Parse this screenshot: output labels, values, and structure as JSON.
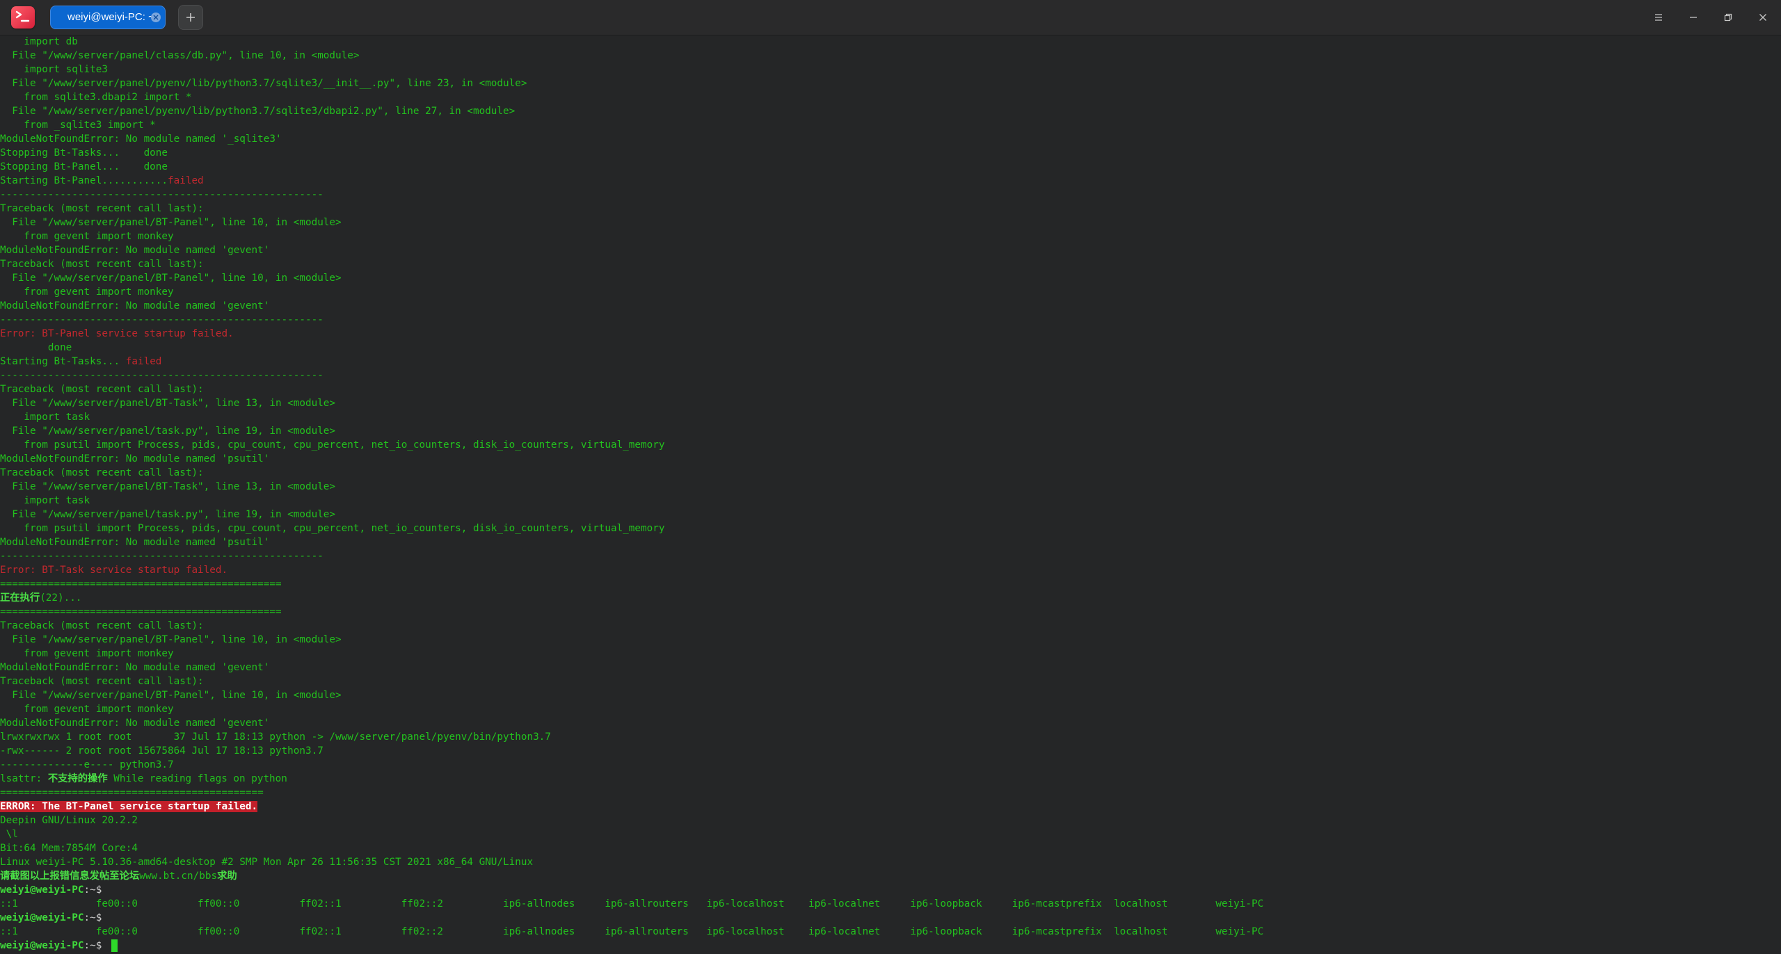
{
  "window": {
    "tab_title": "weiyi@weiyi-PC: ~",
    "icons": {
      "logo": "terminal-logo-icon",
      "tab_close": "close-icon",
      "add_tab": "plus-icon",
      "menu": "menu-icon",
      "minimize": "minimize-icon",
      "maximize": "restore-icon",
      "close": "close-icon"
    }
  },
  "terminal": {
    "lines": [
      [
        [
          "    import db",
          "green"
        ]
      ],
      [
        [
          "  File \"/www/server/panel/class/db.py\", line 10, in <module>",
          "green"
        ]
      ],
      [
        [
          "    import sqlite3",
          "green"
        ]
      ],
      [
        [
          "  File \"/www/server/panel/pyenv/lib/python3.7/sqlite3/__init__.py\", line 23, in <module>",
          "green"
        ]
      ],
      [
        [
          "    from sqlite3.dbapi2 import *",
          "green"
        ]
      ],
      [
        [
          "  File \"/www/server/panel/pyenv/lib/python3.7/sqlite3/dbapi2.py\", line 27, in <module>",
          "green"
        ]
      ],
      [
        [
          "    from _sqlite3 import *",
          "green"
        ]
      ],
      [
        [
          "ModuleNotFoundError: No module named '_sqlite3'",
          "green"
        ]
      ],
      [
        [
          "Stopping Bt-Tasks...    done",
          "green"
        ]
      ],
      [
        [
          "Stopping Bt-Panel...    done",
          "green"
        ]
      ],
      [
        [
          "Starting Bt-Panel...........",
          "green"
        ],
        [
          "failed",
          "red"
        ]
      ],
      [
        [
          "------------------------------------------------------",
          "green"
        ]
      ],
      [
        [
          "Traceback (most recent call last):",
          "green"
        ]
      ],
      [
        [
          "  File \"/www/server/panel/BT-Panel\", line 10, in <module>",
          "green"
        ]
      ],
      [
        [
          "    from gevent import monkey",
          "green"
        ]
      ],
      [
        [
          "ModuleNotFoundError: No module named 'gevent'",
          "green"
        ]
      ],
      [
        [
          "Traceback (most recent call last):",
          "green"
        ]
      ],
      [
        [
          "  File \"/www/server/panel/BT-Panel\", line 10, in <module>",
          "green"
        ]
      ],
      [
        [
          "    from gevent import monkey",
          "green"
        ]
      ],
      [
        [
          "ModuleNotFoundError: No module named 'gevent'",
          "green"
        ]
      ],
      [
        [
          "------------------------------------------------------",
          "green"
        ]
      ],
      [
        [
          "Error: BT-Panel service startup failed.",
          "red"
        ]
      ],
      [
        [
          "        done",
          "green"
        ]
      ],
      [
        [
          "Starting Bt-Tasks... ",
          "green"
        ],
        [
          "failed",
          "red"
        ]
      ],
      [
        [
          "------------------------------------------------------",
          "green"
        ]
      ],
      [
        [
          "Traceback (most recent call last):",
          "green"
        ]
      ],
      [
        [
          "  File \"/www/server/panel/BT-Task\", line 13, in <module>",
          "green"
        ]
      ],
      [
        [
          "    import task",
          "green"
        ]
      ],
      [
        [
          "  File \"/www/server/panel/task.py\", line 19, in <module>",
          "green"
        ]
      ],
      [
        [
          "    from psutil import Process, pids, cpu_count, cpu_percent, net_io_counters, disk_io_counters, virtual_memory",
          "green"
        ]
      ],
      [
        [
          "ModuleNotFoundError: No module named 'psutil'",
          "green"
        ]
      ],
      [
        [
          "Traceback (most recent call last):",
          "green"
        ]
      ],
      [
        [
          "  File \"/www/server/panel/BT-Task\", line 13, in <module>",
          "green"
        ]
      ],
      [
        [
          "    import task",
          "green"
        ]
      ],
      [
        [
          "  File \"/www/server/panel/task.py\", line 19, in <module>",
          "green"
        ]
      ],
      [
        [
          "    from psutil import Process, pids, cpu_count, cpu_percent, net_io_counters, disk_io_counters, virtual_memory",
          "green"
        ]
      ],
      [
        [
          "ModuleNotFoundError: No module named 'psutil'",
          "green"
        ]
      ],
      [
        [
          "------------------------------------------------------",
          "green"
        ]
      ],
      [
        [
          "Error: BT-Task service startup failed.",
          "red"
        ]
      ],
      [
        [
          "===============================================",
          "green"
        ]
      ],
      [
        [
          "正在执行",
          "boldgreen"
        ],
        [
          "(22)...",
          "green"
        ]
      ],
      [
        [
          "===============================================",
          "green"
        ]
      ],
      [
        [
          "Traceback (most recent call last):",
          "green"
        ]
      ],
      [
        [
          "  File \"/www/server/panel/BT-Panel\", line 10, in <module>",
          "green"
        ]
      ],
      [
        [
          "    from gevent import monkey",
          "green"
        ]
      ],
      [
        [
          "ModuleNotFoundError: No module named 'gevent'",
          "green"
        ]
      ],
      [
        [
          "Traceback (most recent call last):",
          "green"
        ]
      ],
      [
        [
          "  File \"/www/server/panel/BT-Panel\", line 10, in <module>",
          "green"
        ]
      ],
      [
        [
          "    from gevent import monkey",
          "green"
        ]
      ],
      [
        [
          "ModuleNotFoundError: No module named 'gevent'",
          "green"
        ]
      ],
      [
        [
          "lrwxrwxrwx 1 root root       37 Jul 17 18:13 python -> /www/server/panel/pyenv/bin/python3.7",
          "green"
        ]
      ],
      [
        [
          "-rwx------ 2 root root 15675864 Jul 17 18:13 python3.7",
          "green"
        ]
      ],
      [
        [
          "--------------e---- python3.7",
          "green"
        ]
      ],
      [
        [
          "lsattr: ",
          "green"
        ],
        [
          "不支持的操作",
          "boldgreen"
        ],
        [
          " While reading flags on python",
          "green"
        ]
      ],
      [
        [
          "============================================",
          "green"
        ]
      ],
      [
        [
          "ERROR: The BT-Panel service startup failed.",
          "err"
        ]
      ],
      [
        [
          "Deepin GNU/Linux 20.2.2",
          "green"
        ]
      ],
      [
        [
          " \\l",
          "green"
        ]
      ],
      [
        [
          "Bit:64 Mem:7854M Core:4",
          "green"
        ]
      ],
      [
        [
          "Linux weiyi-PC 5.10.36-amd64-desktop #2 SMP Mon Apr 26 11:56:35 CST 2021 x86_64 GNU/Linux",
          "green"
        ]
      ],
      [
        [
          "请截图以上报错信息发帖至论坛",
          "boldgreen"
        ],
        [
          "www.bt.cn/bbs",
          "green"
        ],
        [
          "求助",
          "boldgreen"
        ]
      ],
      [
        [
          "weiyi@weiyi-PC",
          "prompt"
        ],
        [
          ":~$",
          "white"
        ]
      ],
      [
        [
          "::1             fe00::0          ff00::0          ff02::1          ff02::2          ip6-allnodes     ip6-allrouters   ip6-localhost    ip6-localnet     ip6-loopback     ip6-mcastprefix  localhost        weiyi-PC",
          "green"
        ]
      ],
      [
        [
          "weiyi@weiyi-PC",
          "prompt"
        ],
        [
          ":~$",
          "white"
        ]
      ],
      [
        [
          "::1             fe00::0          ff00::0          ff02::1          ff02::2          ip6-allnodes     ip6-allrouters   ip6-localhost    ip6-localnet     ip6-loopback     ip6-mcastprefix  localhost        weiyi-PC",
          "green"
        ]
      ],
      [
        [
          "weiyi@weiyi-PC",
          "prompt"
        ],
        [
          ":~$ ",
          "white"
        ]
      ]
    ]
  }
}
